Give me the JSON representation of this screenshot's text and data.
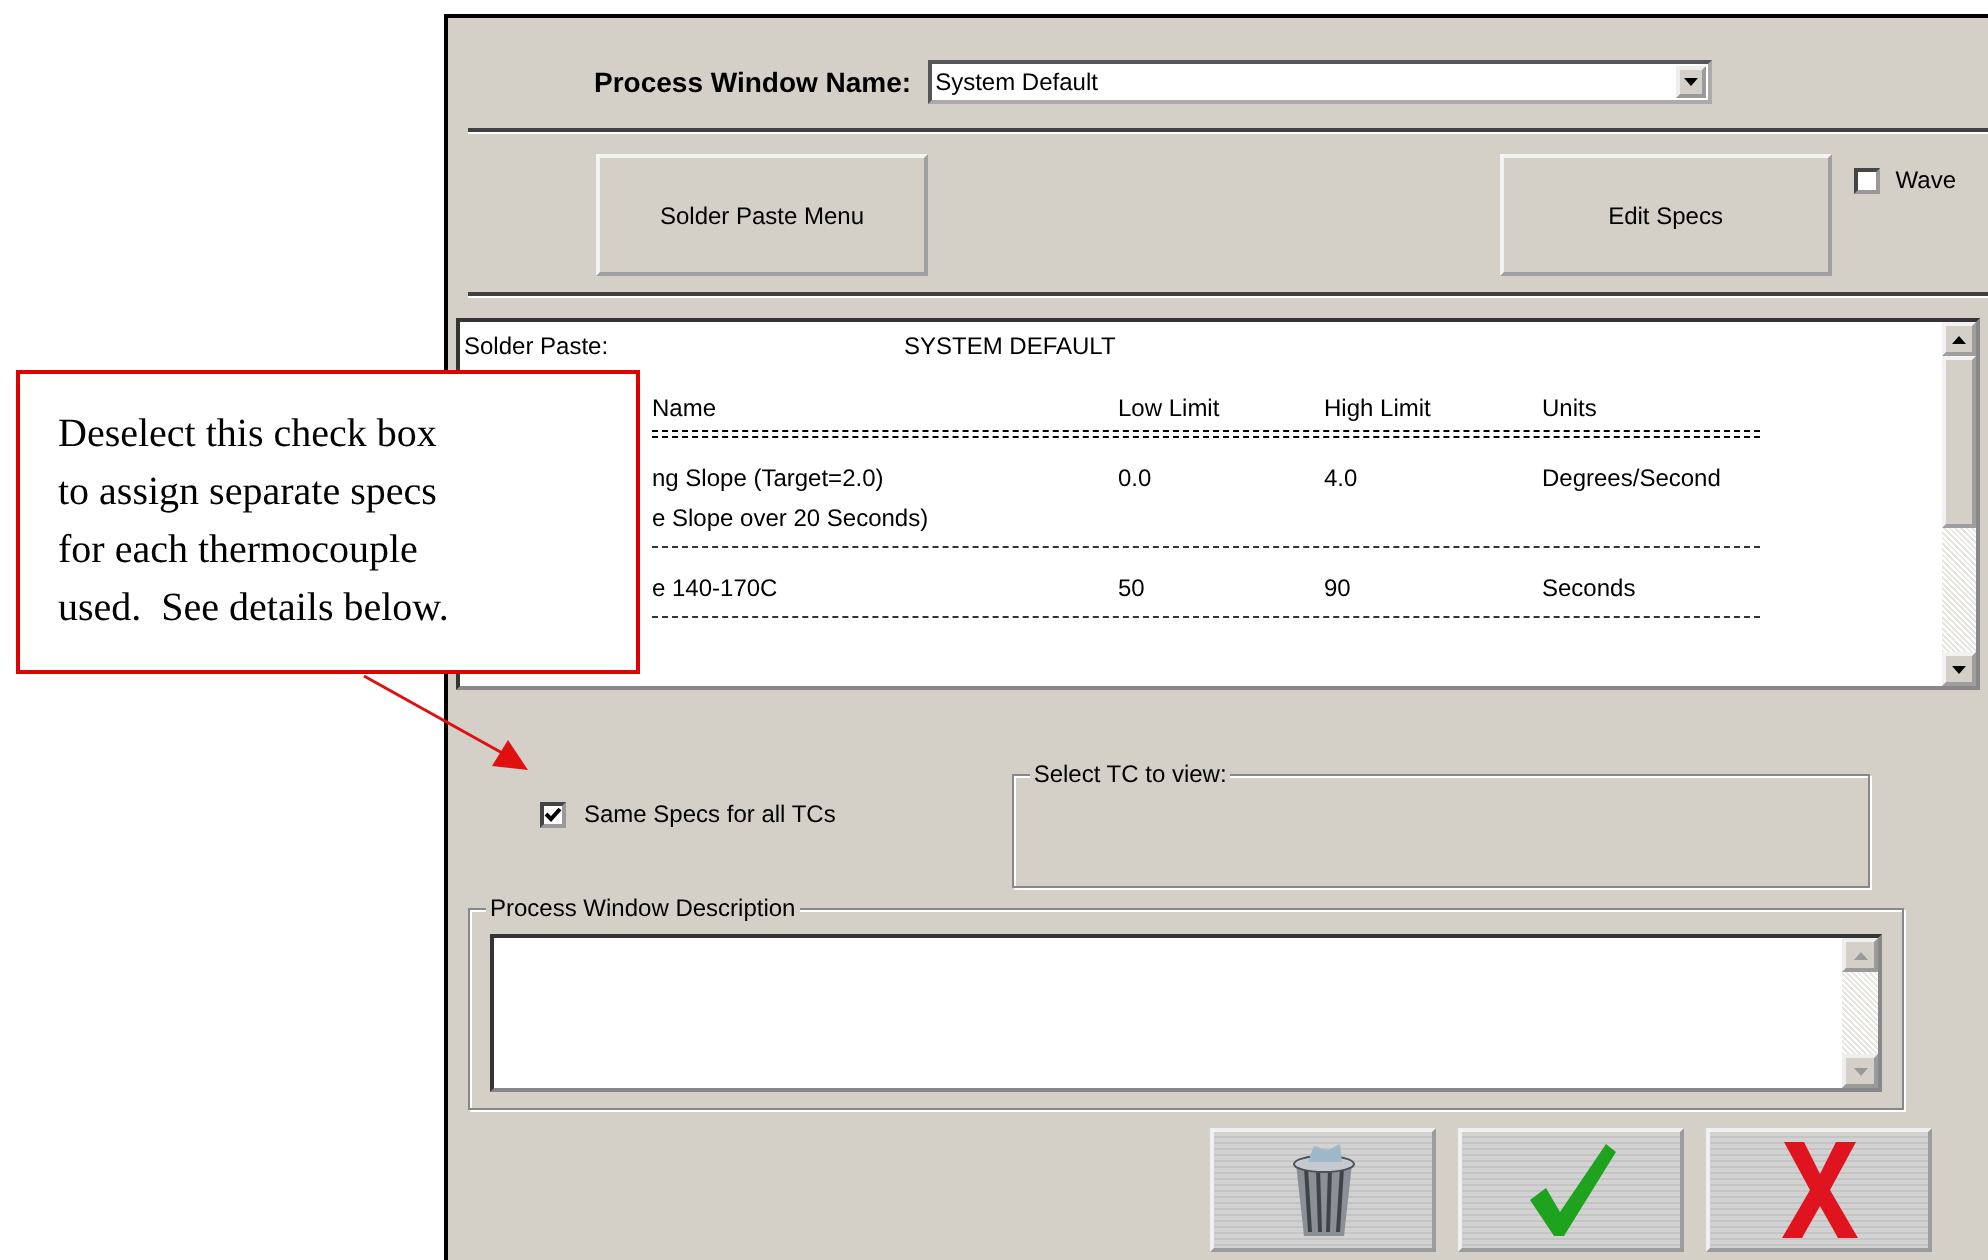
{
  "process_window_name": {
    "label": "Process Window Name:",
    "value": "System Default"
  },
  "buttons": {
    "solder_paste_menu": "Solder Paste Menu",
    "edit_specs": "Edit Specs"
  },
  "wave": {
    "label": "Wave",
    "checked": false
  },
  "spec_list": {
    "solder_paste_label": "Solder Paste:",
    "solder_paste_value": "SYSTEM DEFAULT",
    "columns": [
      "Name",
      "Low Limit",
      "High Limit",
      "Units"
    ],
    "rows": [
      {
        "name": [
          "ng Slope (Target=2.0)",
          "e Slope over 20 Seconds)"
        ],
        "low": "0.0",
        "high": "4.0",
        "units": "Degrees/Second"
      },
      {
        "name": [
          "e 140-170C"
        ],
        "low": "50",
        "high": "90",
        "units": "Seconds"
      }
    ]
  },
  "same_specs": {
    "label": "Same Specs for all TCs",
    "checked": true
  },
  "select_tc": {
    "label": "Select TC to view:"
  },
  "description": {
    "label": "Process Window Description"
  },
  "action_buttons": [
    {
      "kind": "delete"
    },
    {
      "kind": "ok"
    },
    {
      "kind": "cancel"
    }
  ],
  "callout": {
    "lines": [
      "Deselect this check box",
      "to assign separate specs",
      "for each thermocouple",
      "used.  See details below."
    ]
  }
}
